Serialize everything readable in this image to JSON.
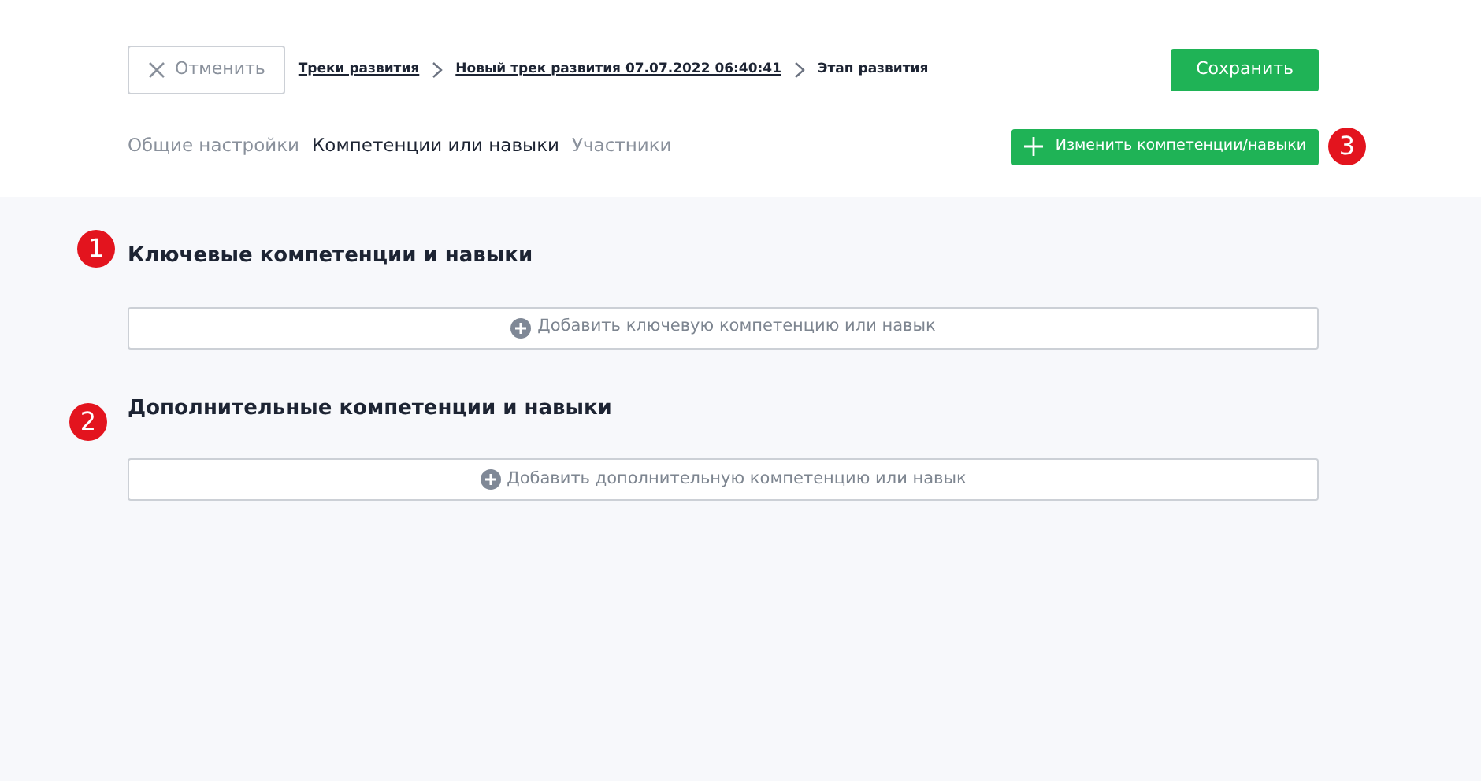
{
  "header": {
    "cancel_button": "Отменить",
    "breadcrumbs": [
      {
        "label": "Треки развития",
        "link": true
      },
      {
        "label": "Новый трек развития 07.07.2022 06:40:41",
        "link": true
      },
      {
        "label": "Этап развития",
        "link": false
      }
    ],
    "save_button": "Сохранить",
    "tabs": [
      {
        "label": "Общие настройки",
        "selected": false
      },
      {
        "label": "Компетенции или навыки",
        "selected": true
      },
      {
        "label": "Участники",
        "selected": false
      }
    ],
    "edit_button": {
      "label": "Изменить компетенции/навыки",
      "marker": "3"
    }
  },
  "sections": [
    {
      "title": "Ключевые компетенции и навыки",
      "add_label": "Добавить ключевую компетенцию или навык",
      "marker": "1"
    },
    {
      "title": "Дополнительные компетенции и навыки",
      "add_label": "Добавить дополнительную компетенцию или навык",
      "marker": "2"
    }
  ]
}
